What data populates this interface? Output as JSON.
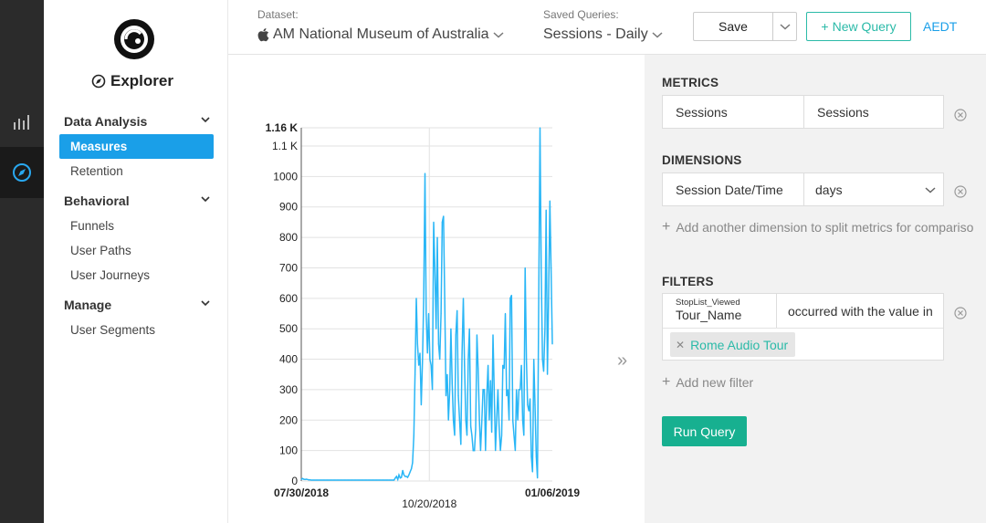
{
  "sidebar": {
    "title": "Explorer",
    "sections": [
      {
        "label": "Data Analysis",
        "items": [
          "Measures",
          "Retention"
        ]
      },
      {
        "label": "Behavioral",
        "items": [
          "Funnels",
          "User Paths",
          "User Journeys"
        ]
      },
      {
        "label": "Manage",
        "items": [
          "User Segments"
        ]
      }
    ],
    "active_item": "Measures"
  },
  "topbar": {
    "dataset_label": "Dataset:",
    "dataset_value": "AM National Museum of Australia",
    "saved_label": "Saved Queries:",
    "saved_value": "Sessions - Daily",
    "save_button": "Save",
    "new_query_button": "New Query",
    "timezone": "AEDT"
  },
  "panel": {
    "metrics_title": "METRICS",
    "metric_left": "Sessions",
    "metric_right": "Sessions",
    "dimensions_title": "DIMENSIONS",
    "dimension_left": "Session Date/Time",
    "dimension_right": "days",
    "add_dimension": "Add another dimension to split metrics for compariso",
    "filters_title": "FILTERS",
    "filter_event": "StopList_Viewed",
    "filter_prop": "Tour_Name",
    "filter_op": "occurred with the value in",
    "filter_tag": "Rome Audio Tour",
    "add_filter": "Add new filter",
    "run_button": "Run Query"
  },
  "chart_data": {
    "type": "line",
    "x_tick_labels": [
      "07/30/2018",
      "10/20/2018",
      "01/06/2019"
    ],
    "y_tick_labels": [
      "0",
      "100",
      "200",
      "300",
      "400",
      "500",
      "600",
      "700",
      "800",
      "900",
      "1000",
      "1.1 K",
      "1.16 K"
    ],
    "ylim": [
      0,
      1160
    ],
    "grid": true,
    "series": [
      {
        "color": "#29b6f6",
        "values": [
          5,
          8,
          6,
          5,
          6,
          5,
          4,
          4,
          3,
          3,
          3,
          3,
          3,
          3,
          3,
          3,
          3,
          3,
          3,
          3,
          3,
          3,
          3,
          3,
          3,
          3,
          3,
          3,
          3,
          3,
          3,
          3,
          3,
          3,
          3,
          3,
          3,
          3,
          3,
          3,
          3,
          3,
          3,
          3,
          3,
          3,
          3,
          3,
          3,
          3,
          3,
          3,
          3,
          3,
          3,
          3,
          3,
          3,
          3,
          3,
          3,
          3,
          3,
          3,
          3,
          3,
          3,
          3,
          3,
          3,
          3,
          3,
          3,
          3,
          3,
          3,
          10,
          15,
          5,
          20,
          10,
          12,
          35,
          20,
          15,
          15,
          12,
          20,
          30,
          40,
          60,
          150,
          350,
          600,
          450,
          380,
          420,
          250,
          400,
          600,
          1010,
          550,
          420,
          550,
          400,
          380,
          300,
          850,
          700,
          500,
          800,
          450,
          400,
          550,
          850,
          870,
          600,
          280,
          350,
          200,
          300,
          500,
          320,
          200,
          150,
          480,
          560,
          280,
          200,
          120,
          420,
          600,
          380,
          200,
          150,
          400,
          500,
          180,
          150,
          100,
          100,
          170,
          480,
          370,
          200,
          100,
          200,
          300,
          300,
          100,
          280,
          380,
          200,
          330,
          160,
          480,
          300,
          100,
          200,
          300,
          180,
          100,
          150,
          380,
          370,
          550,
          280,
          300,
          200,
          600,
          610,
          200,
          150,
          100,
          300,
          200,
          300,
          300,
          380,
          200,
          150,
          700,
          400,
          250,
          230,
          270,
          80,
          30,
          400,
          250,
          80,
          10,
          600,
          1160,
          700,
          400,
          360,
          500,
          890,
          350,
          600,
          920,
          700,
          450
        ]
      }
    ]
  }
}
